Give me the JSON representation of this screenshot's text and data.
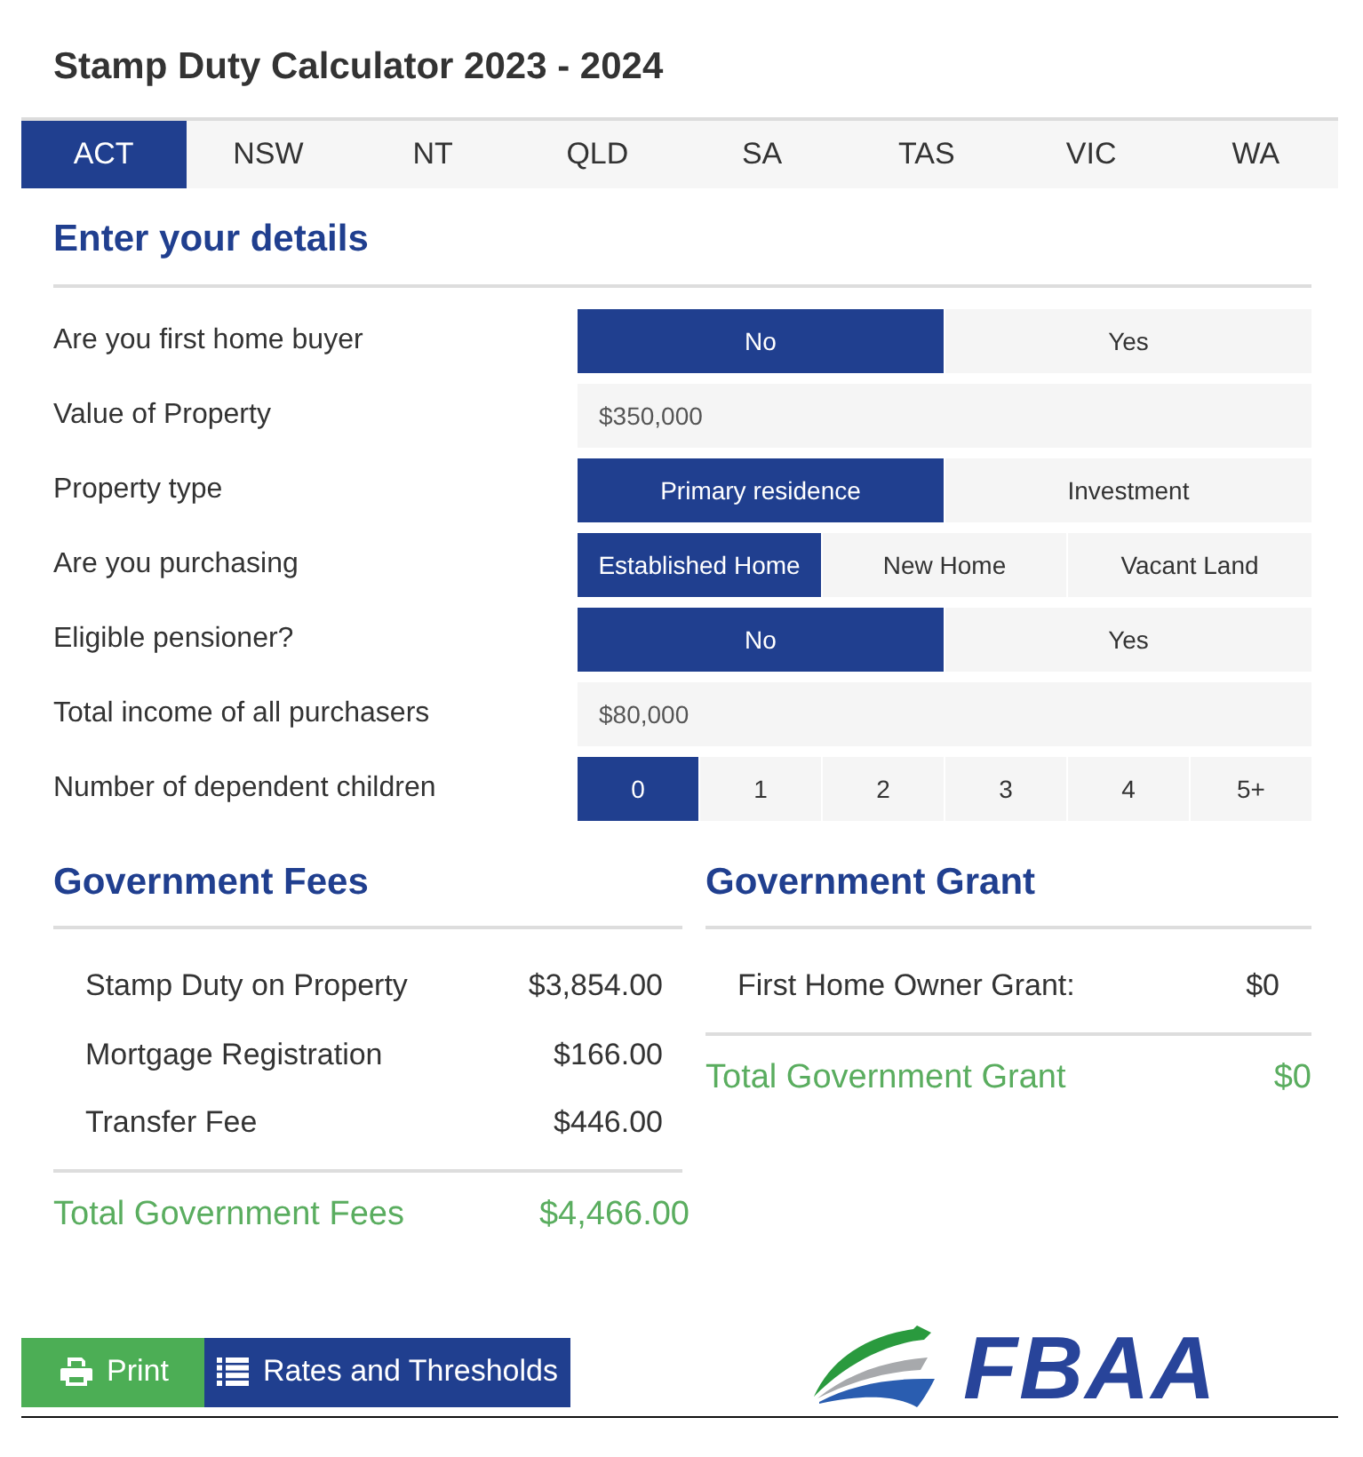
{
  "title": "Stamp Duty Calculator 2023 - 2024",
  "tabs": [
    {
      "label": "ACT",
      "selected": true
    },
    {
      "label": "NSW",
      "selected": false
    },
    {
      "label": "NT",
      "selected": false
    },
    {
      "label": "QLD",
      "selected": false
    },
    {
      "label": "SA",
      "selected": false
    },
    {
      "label": "TAS",
      "selected": false
    },
    {
      "label": "VIC",
      "selected": false
    },
    {
      "label": "WA",
      "selected": false
    }
  ],
  "details": {
    "heading": "Enter your details",
    "fields": [
      {
        "kind": "choice",
        "label": "Are you first home buyer",
        "options": [
          {
            "label": "No",
            "selected": true
          },
          {
            "label": "Yes",
            "selected": false
          }
        ]
      },
      {
        "kind": "input",
        "label": "Value of Property",
        "value": "$350,000"
      },
      {
        "kind": "choice",
        "label": "Property type",
        "options": [
          {
            "label": "Primary residence",
            "selected": true
          },
          {
            "label": "Investment",
            "selected": false
          }
        ]
      },
      {
        "kind": "choice",
        "label": "Are you purchasing",
        "options": [
          {
            "label": "Established Home",
            "selected": true
          },
          {
            "label": "New Home",
            "selected": false
          },
          {
            "label": "Vacant Land",
            "selected": false
          }
        ]
      },
      {
        "kind": "choice",
        "label": "Eligible pensioner?",
        "options": [
          {
            "label": "No",
            "selected": true
          },
          {
            "label": "Yes",
            "selected": false
          }
        ]
      },
      {
        "kind": "input",
        "label": "Total income of all purchasers",
        "value": "$80,000"
      },
      {
        "kind": "choice",
        "label": "Number of dependent children",
        "options": [
          {
            "label": "0",
            "selected": true
          },
          {
            "label": "1",
            "selected": false
          },
          {
            "label": "2",
            "selected": false
          },
          {
            "label": "3",
            "selected": false
          },
          {
            "label": "4",
            "selected": false
          },
          {
            "label": "5+",
            "selected": false
          }
        ]
      }
    ]
  },
  "fees": {
    "heading": "Government Fees",
    "items": [
      {
        "label": "Stamp Duty on Property",
        "amount": "$3,854.00"
      },
      {
        "label": "Mortgage Registration",
        "amount": "$166.00"
      },
      {
        "label": "Transfer Fee",
        "amount": "$446.00"
      }
    ],
    "total": {
      "label": "Total Government Fees",
      "amount": "$4,466.00"
    }
  },
  "grant": {
    "heading": "Government Grant",
    "items": [
      {
        "label": "First Home Owner Grant:",
        "amount": "$0"
      }
    ],
    "total": {
      "label": "Total Government Grant",
      "amount": "$0"
    }
  },
  "buttons": [
    {
      "kind": "print",
      "label": "Print"
    },
    {
      "kind": "list",
      "label": "Rates and Thresholds"
    }
  ],
  "logo": {
    "text": "FBAA"
  }
}
